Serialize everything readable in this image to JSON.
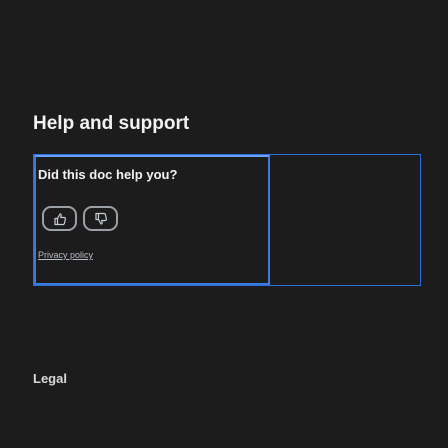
{
  "help": {
    "title": "Help and support"
  },
  "feedback": {
    "question": "Did this doc help you?",
    "thumbs_up_icon": "thumbs-up-icon",
    "thumbs_down_icon": "thumbs-down-icon",
    "privacy_link": "Privacy policy"
  },
  "legal": {
    "heading": "Legal"
  },
  "colors": {
    "background": "#1c1c1c",
    "focus_outline": "#2d6fd6",
    "text": "#f2f2f2"
  }
}
